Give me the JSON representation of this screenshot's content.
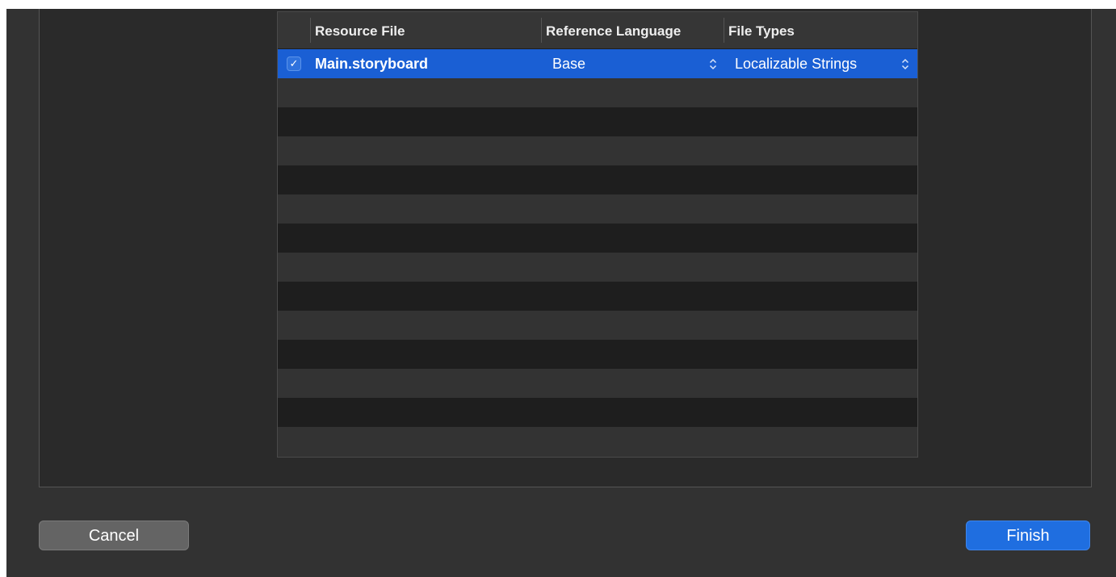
{
  "table": {
    "columns": [
      "",
      "Resource File",
      "Reference Language",
      "File Types"
    ],
    "rows": [
      {
        "checked": true,
        "resource_file": "Main.storyboard",
        "reference_language": "Base",
        "file_types": "Localizable Strings"
      }
    ],
    "checkmark": "✓",
    "empty_row_count": 13
  },
  "buttons": {
    "cancel": "Cancel",
    "finish": "Finish"
  },
  "colors": {
    "selection": "#1a5fd4",
    "primary_button": "#1f6ee0",
    "background": "#323232"
  },
  "icons": {
    "checkbox": "checkmark-icon",
    "popup": "up-down-chevron-icon"
  }
}
